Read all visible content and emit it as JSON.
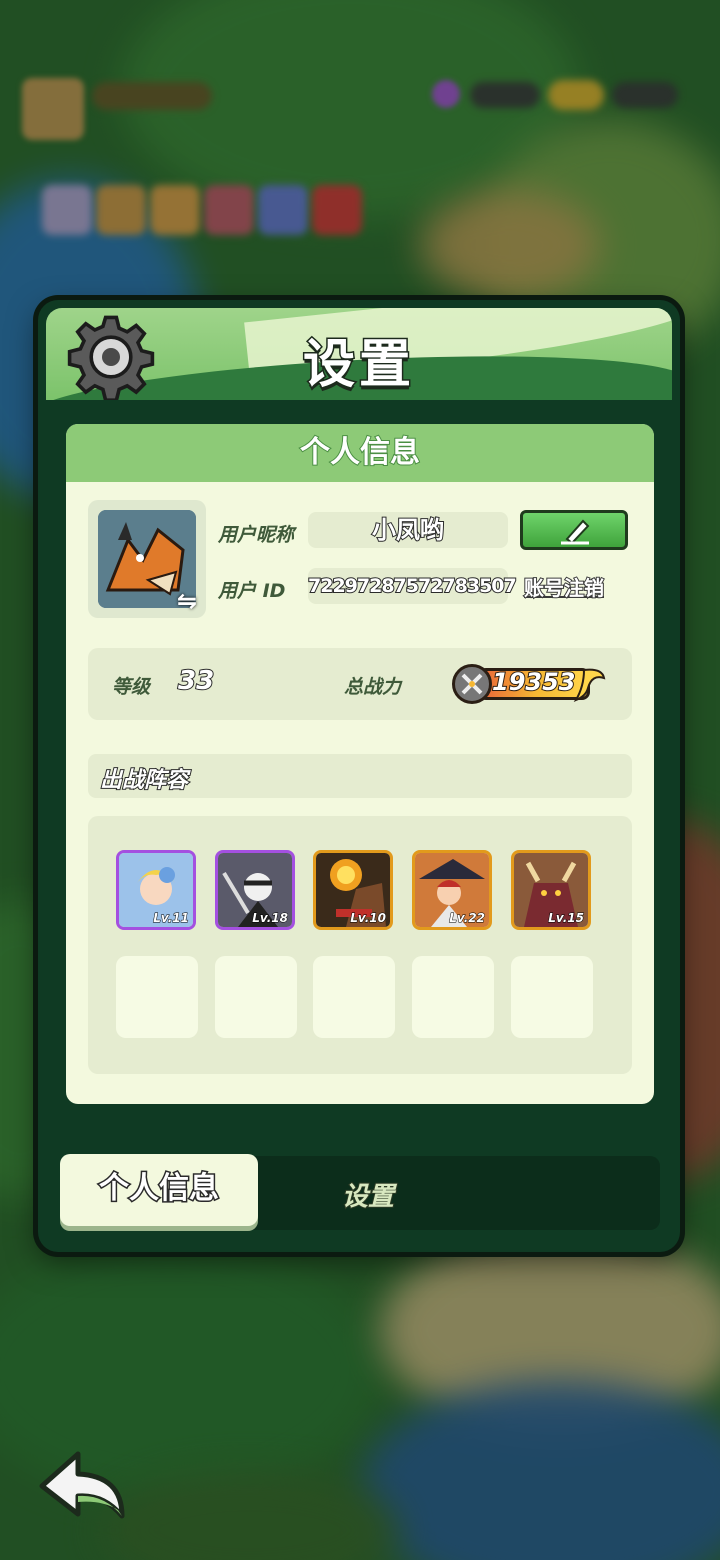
{
  "window": {
    "title": "设置"
  },
  "profile": {
    "section_title": "个人信息",
    "nickname_label": "用户昵称",
    "nickname": "小凤哟",
    "id_label": "用户 ID",
    "user_id": "72297287572783507",
    "logout_label": "账号注销",
    "level_label": "等级",
    "level": "33",
    "power_label": "总战力",
    "power": "19353"
  },
  "lineup": {
    "title": "出战阵容",
    "heroes": [
      {
        "level": "Lv.11",
        "rarity": "purple",
        "color": "#7aa4d8"
      },
      {
        "level": "Lv.18",
        "rarity": "purple",
        "color": "#4a4a5a"
      },
      {
        "level": "Lv.10",
        "rarity": "gold",
        "color": "#c9552b"
      },
      {
        "level": "Lv.22",
        "rarity": "gold",
        "color": "#8a3a2a"
      },
      {
        "level": "Lv.15",
        "rarity": "gold",
        "color": "#7a2a30"
      }
    ],
    "empty_slots": 5
  },
  "tabs": [
    {
      "label": "个人信息",
      "active": true
    },
    {
      "label": "设置",
      "active": false
    }
  ],
  "icons": {
    "gear": "gear-icon",
    "edit": "pencil-icon",
    "swap": "swap-icon",
    "power": "crossed-swords-icon",
    "back": "back-arrow-icon"
  },
  "colors": {
    "header_green": "#8dca77",
    "panel_bg": "#f3f9de",
    "window_bg": "#0f3a23",
    "rarity_purple": "#a450e0",
    "rarity_gold": "#e29a1c"
  }
}
